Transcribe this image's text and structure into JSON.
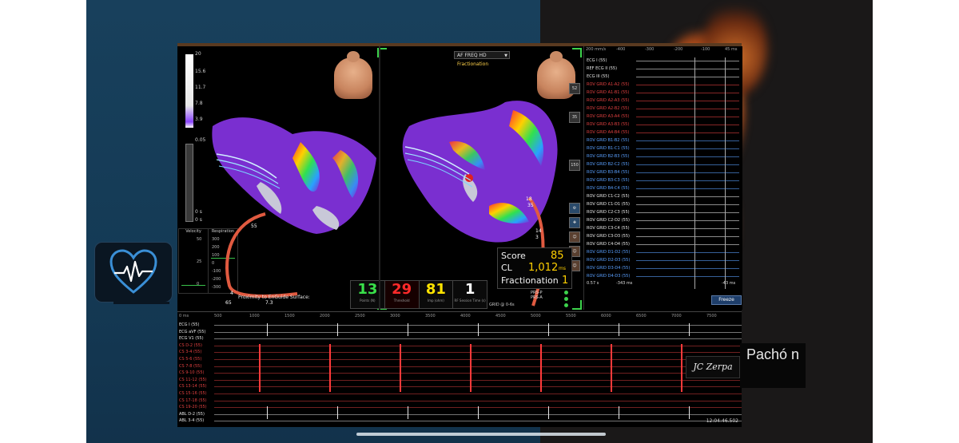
{
  "colors": {
    "accent_green": "#3cd24b",
    "score_yellow": "#ffd000",
    "map_purple": "#7a2fd0",
    "catheter_red": "#e05a40",
    "ecg_red": "#ff3a3a"
  },
  "map_left": {
    "scale_ticks": [
      "20",
      "15.6",
      "11.7",
      "7.8",
      "3.9",
      "0.05",
      "0 s",
      "0 s"
    ],
    "velocity": {
      "label": "Velocity",
      "values": [
        "50",
        "25",
        "0"
      ]
    },
    "respiration": {
      "label": "Respiration",
      "values": [
        "300",
        "200",
        "100",
        "0",
        "-100",
        "-200",
        "-300"
      ]
    },
    "electrode_labels": [
      "55",
      "65",
      "4",
      "7.3"
    ],
    "proximity_text": "Proximity to EnGuide Surface:"
  },
  "map_right": {
    "dropdown_value": "AF FREQ HD",
    "mode_label": "Fractionation",
    "electrode_labels": [
      "35",
      "14",
      "18",
      "3"
    ],
    "tool_labels": [
      "52",
      "35",
      "150"
    ],
    "stats": {
      "score_label": "Score",
      "score_value": "85",
      "cl_label": "CL",
      "cl_value": "1,012",
      "cl_unit": "ms",
      "frac_label": "Fractionation",
      "frac_value": "1"
    },
    "prs_labels": [
      "PRS-P",
      "PRS-A"
    ],
    "grid_text": "GRID @ 0-6s"
  },
  "counters": [
    {
      "value": "13",
      "label": "Points (N)",
      "color": "#39e04a"
    },
    {
      "value": "29",
      "label": "Threshold",
      "color": "#ff2a2a"
    },
    {
      "value": "81",
      "label": "Imp (ohm)",
      "color": "#ffe400"
    },
    {
      "value": "1",
      "label": "RF Session Time (s)",
      "color": "#ffffff"
    }
  ],
  "ecg_side": {
    "ticks": [
      "200 mm/s",
      "-400",
      "-300",
      "-200",
      "-100",
      "45 ms"
    ],
    "channels": [
      {
        "label": "ECG I (55)",
        "color": "#e8e8e8"
      },
      {
        "label": "REF ECG II (55)",
        "color": "#e8e8e8"
      },
      {
        "label": "ECG III (55)",
        "color": "#e8e8e8"
      },
      {
        "label": "ROV GRID  A1-A2 (55)",
        "color": "#e04040"
      },
      {
        "label": "ROV GRID  A1-B1 (55)",
        "color": "#e04040"
      },
      {
        "label": "ROV GRID  A2-A3 (55)",
        "color": "#e04040"
      },
      {
        "label": "ROV GRID  A2-B2 (55)",
        "color": "#e04040"
      },
      {
        "label": "ROV GRID  A3-A4 (55)",
        "color": "#e04040"
      },
      {
        "label": "ROV GRID  A3-B3 (55)",
        "color": "#e04040"
      },
      {
        "label": "ROV GRID  A4-B4 (55)",
        "color": "#e04040"
      },
      {
        "label": "ROV GRID  B1-B2 (55)",
        "color": "#5aa0ff"
      },
      {
        "label": "ROV GRID  B1-C1 (55)",
        "color": "#5aa0ff"
      },
      {
        "label": "ROV GRID  B2-B3 (55)",
        "color": "#5aa0ff"
      },
      {
        "label": "ROV GRID  B2-C2 (55)",
        "color": "#5aa0ff"
      },
      {
        "label": "ROV GRID  B3-B4 (55)",
        "color": "#5aa0ff"
      },
      {
        "label": "ROV GRID  B3-C3 (55)",
        "color": "#5aa0ff"
      },
      {
        "label": "ROV GRID  B4-C4 (55)",
        "color": "#5aa0ff"
      },
      {
        "label": "ROV GRID  C1-C2 (55)",
        "color": "#e8e8e8"
      },
      {
        "label": "ROV GRID  C1-D1 (55)",
        "color": "#e8e8e8"
      },
      {
        "label": "ROV GRID  C2-C3 (55)",
        "color": "#e8e8e8"
      },
      {
        "label": "ROV GRID  C2-D2 (55)",
        "color": "#e8e8e8"
      },
      {
        "label": "ROV GRID  C3-C4 (55)",
        "color": "#e8e8e8"
      },
      {
        "label": "ROV GRID  C3-D3 (55)",
        "color": "#e8e8e8"
      },
      {
        "label": "ROV GRID  C4-D4 (55)",
        "color": "#e8e8e8"
      },
      {
        "label": "ROV GRID  D1-D2 (55)",
        "color": "#5aa0ff"
      },
      {
        "label": "ROV GRID  D2-D3 (55)",
        "color": "#5aa0ff"
      },
      {
        "label": "ROV GRID  D3-D4 (55)",
        "color": "#5aa0ff"
      },
      {
        "label": "ROV GRID  D4-D3 (55)",
        "color": "#5aa0ff"
      }
    ],
    "bottom_left": "0.57 s",
    "bottom_mid": "-343 ms",
    "bottom_right": "-43 ms",
    "freeze_label": "Freeze"
  },
  "bottom_panel": {
    "ticks": [
      "0 ms",
      "500",
      "1000",
      "1500",
      "2000",
      "2500",
      "3000",
      "3500",
      "4000",
      "4500",
      "5000",
      "5500",
      "6000",
      "6500",
      "7000",
      "7500"
    ],
    "channels": [
      {
        "label": "ECG I (55)",
        "color": "#e8e8e8"
      },
      {
        "label": "ECG aVF (55)",
        "color": "#e8e8e8"
      },
      {
        "label": "ECG V1 (55)",
        "color": "#e8e8e8"
      },
      {
        "label": "CS  D-2 (55)",
        "color": "#e04040"
      },
      {
        "label": "CS  3-4 (55)",
        "color": "#e04040"
      },
      {
        "label": "CS  5-6 (55)",
        "color": "#e04040"
      },
      {
        "label": "CS  7-8 (55)",
        "color": "#e04040"
      },
      {
        "label": "CS  9-10 (55)",
        "color": "#e04040"
      },
      {
        "label": "CS  11-12 (55)",
        "color": "#e04040"
      },
      {
        "label": "CS  13-14 (55)",
        "color": "#e04040"
      },
      {
        "label": "CS  15-16 (55)",
        "color": "#e04040"
      },
      {
        "label": "CS  17-18 (55)",
        "color": "#e04040"
      },
      {
        "label": "CS  19-20 (55)",
        "color": "#e04040"
      },
      {
        "label": "ABL  D-2 (55)",
        "color": "#e8e8e8"
      },
      {
        "label": "ABL  3-4 (55)",
        "color": "#e8e8e8"
      }
    ],
    "timestamp": "12:04:46.502"
  },
  "watermark": "JC Zerpa",
  "presenter_name": "Pachó n"
}
